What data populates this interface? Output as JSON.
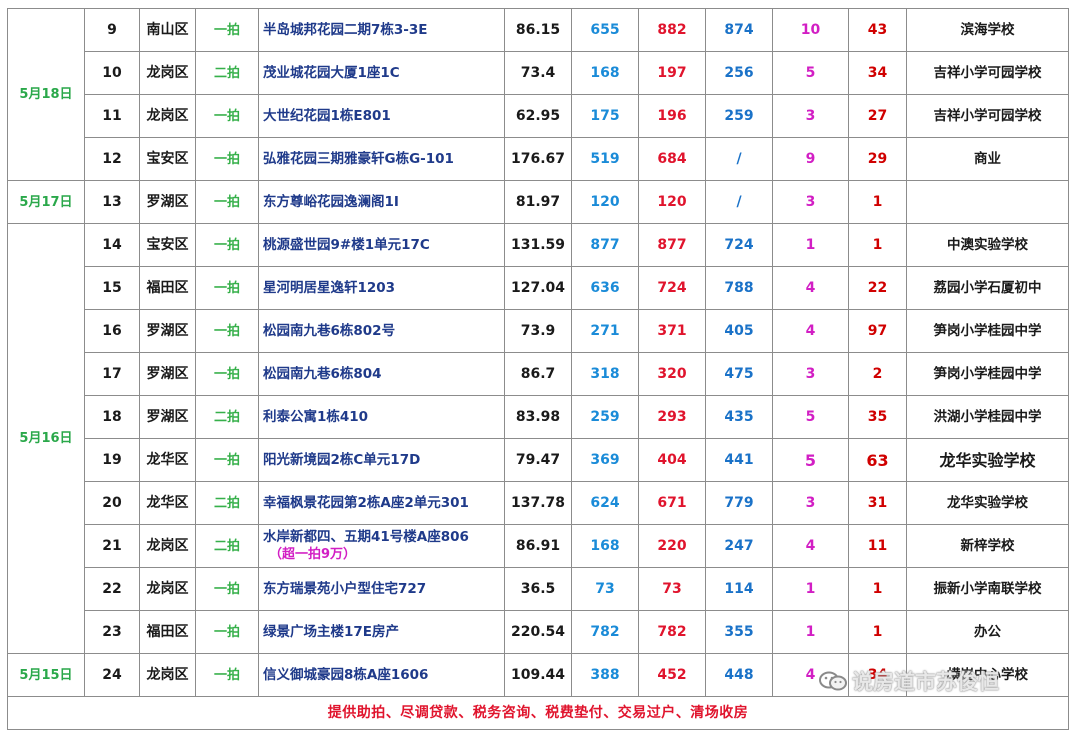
{
  "rows": [
    {
      "date": "",
      "no": "9",
      "district": "南山区",
      "round": "一拍",
      "property": "半岛城邦花园二期7栋3-3E",
      "area": "86.15",
      "start": "655",
      "deal": "882",
      "ref": "874",
      "bids": "10",
      "looks": "43",
      "school": "滨海学校"
    },
    {
      "date": "",
      "no": "10",
      "district": "龙岗区",
      "round": "二拍",
      "property": "茂业城花园大厦1座1C",
      "area": "73.4",
      "start": "168",
      "deal": "197",
      "ref": "256",
      "bids": "5",
      "looks": "34",
      "school": "吉祥小学可园学校"
    },
    {
      "date": "",
      "no": "11",
      "district": "龙岗区",
      "round": "一拍",
      "property": "大世纪花园1栋E801",
      "area": "62.95",
      "start": "175",
      "deal": "196",
      "ref": "259",
      "bids": "3",
      "looks": "27",
      "school": "吉祥小学可园学校"
    },
    {
      "date": "",
      "no": "12",
      "district": "宝安区",
      "round": "一拍",
      "property": "弘雅花园三期雅豪轩G栋G-101",
      "area": "176.67",
      "start": "519",
      "deal": "684",
      "ref": "/",
      "bids": "9",
      "looks": "29",
      "school": "商业"
    },
    {
      "date": "",
      "no": "13",
      "district": "罗湖区",
      "round": "一拍",
      "property": "东方尊峪花园逸澜阁1I",
      "area": "81.97",
      "start": "120",
      "deal": "120",
      "ref": "/",
      "bids": "3",
      "looks": "1",
      "school": ""
    },
    {
      "date": "",
      "no": "14",
      "district": "宝安区",
      "round": "一拍",
      "property": "桃源盛世园9#楼1单元17C",
      "area": "131.59",
      "start": "877",
      "deal": "877",
      "ref": "724",
      "bids": "1",
      "looks": "1",
      "school": "中澳实验学校"
    },
    {
      "date": "",
      "no": "15",
      "district": "福田区",
      "round": "一拍",
      "property": "星河明居星逸轩1203",
      "area": "127.04",
      "start": "636",
      "deal": "724",
      "ref": "788",
      "bids": "4",
      "looks": "22",
      "school": "荔园小学石厦初中"
    },
    {
      "date": "",
      "no": "16",
      "district": "罗湖区",
      "round": "一拍",
      "property": "松园南九巷6栋802号",
      "area": "73.9",
      "start": "271",
      "deal": "371",
      "ref": "405",
      "bids": "4",
      "looks": "97",
      "school": "笋岗小学桂园中学"
    },
    {
      "date": "",
      "no": "17",
      "district": "罗湖区",
      "round": "一拍",
      "property": "松园南九巷6栋804",
      "area": "86.7",
      "start": "318",
      "deal": "320",
      "ref": "475",
      "bids": "3",
      "looks": "2",
      "school": "笋岗小学桂园中学"
    },
    {
      "date": "",
      "no": "18",
      "district": "罗湖区",
      "round": "二拍",
      "property": "利泰公寓1栋410",
      "area": "83.98",
      "start": "259",
      "deal": "293",
      "ref": "435",
      "bids": "5",
      "looks": "35",
      "school": "洪湖小学桂园中学"
    },
    {
      "date": "",
      "no": "19",
      "district": "龙华区",
      "round": "一拍",
      "property": "阳光新境园2栋C单元17D",
      "area": "79.47",
      "start": "369",
      "deal": "404",
      "ref": "441",
      "bids": "5",
      "looks": "63",
      "school": "龙华实验学校"
    },
    {
      "date": "",
      "no": "20",
      "district": "龙华区",
      "round": "二拍",
      "property": "幸福枫景花园第2栋A座2单元301",
      "area": "137.78",
      "start": "624",
      "deal": "671",
      "ref": "779",
      "bids": "3",
      "looks": "31",
      "school": "龙华实验学校"
    },
    {
      "date": "",
      "no": "21",
      "district": "龙岗区",
      "round": "二拍",
      "property": "水岸新都四、五期41号楼A座806",
      "note": "（超一拍9万）",
      "area": "86.91",
      "start": "168",
      "deal": "220",
      "ref": "247",
      "bids": "4",
      "looks": "11",
      "school": "新梓学校"
    },
    {
      "date": "",
      "no": "22",
      "district": "龙岗区",
      "round": "一拍",
      "property": "东方瑞景苑小户型住宅727",
      "area": "36.5",
      "start": "73",
      "deal": "73",
      "ref": "114",
      "bids": "1",
      "looks": "1",
      "school": "振新小学南联学校"
    },
    {
      "date": "",
      "no": "23",
      "district": "福田区",
      "round": "一拍",
      "property": "绿景广场主楼17E房产",
      "area": "220.54",
      "start": "782",
      "deal": "782",
      "ref": "355",
      "bids": "1",
      "looks": "1",
      "school": "办公"
    },
    {
      "date": "",
      "no": "24",
      "district": "龙岗区",
      "round": "一拍",
      "property": "信义御城豪园8栋A座1606",
      "area": "109.44",
      "start": "388",
      "deal": "452",
      "ref": "448",
      "bids": "4",
      "looks": "34",
      "school": "横岗中心学校"
    }
  ],
  "dates": {
    "may18": "5月18日",
    "may17": "5月17日",
    "may16": "5月16日",
    "may15": "5月15日"
  },
  "footer": "提供助拍、尽调贷款、税务咨询、税费垫付、交易过户、清场收房",
  "watermark": "说房道市苏俊恒",
  "colors": {
    "date": "#2aa84a",
    "round": "#36b04a",
    "property": "#1f3a8a",
    "start_price": "#1a8bd8",
    "deal_price": "#e0142d",
    "ref_price": "#1a72c8",
    "bids": "#d21ec4",
    "looks": "#d00000",
    "footer": "#e0142d"
  }
}
